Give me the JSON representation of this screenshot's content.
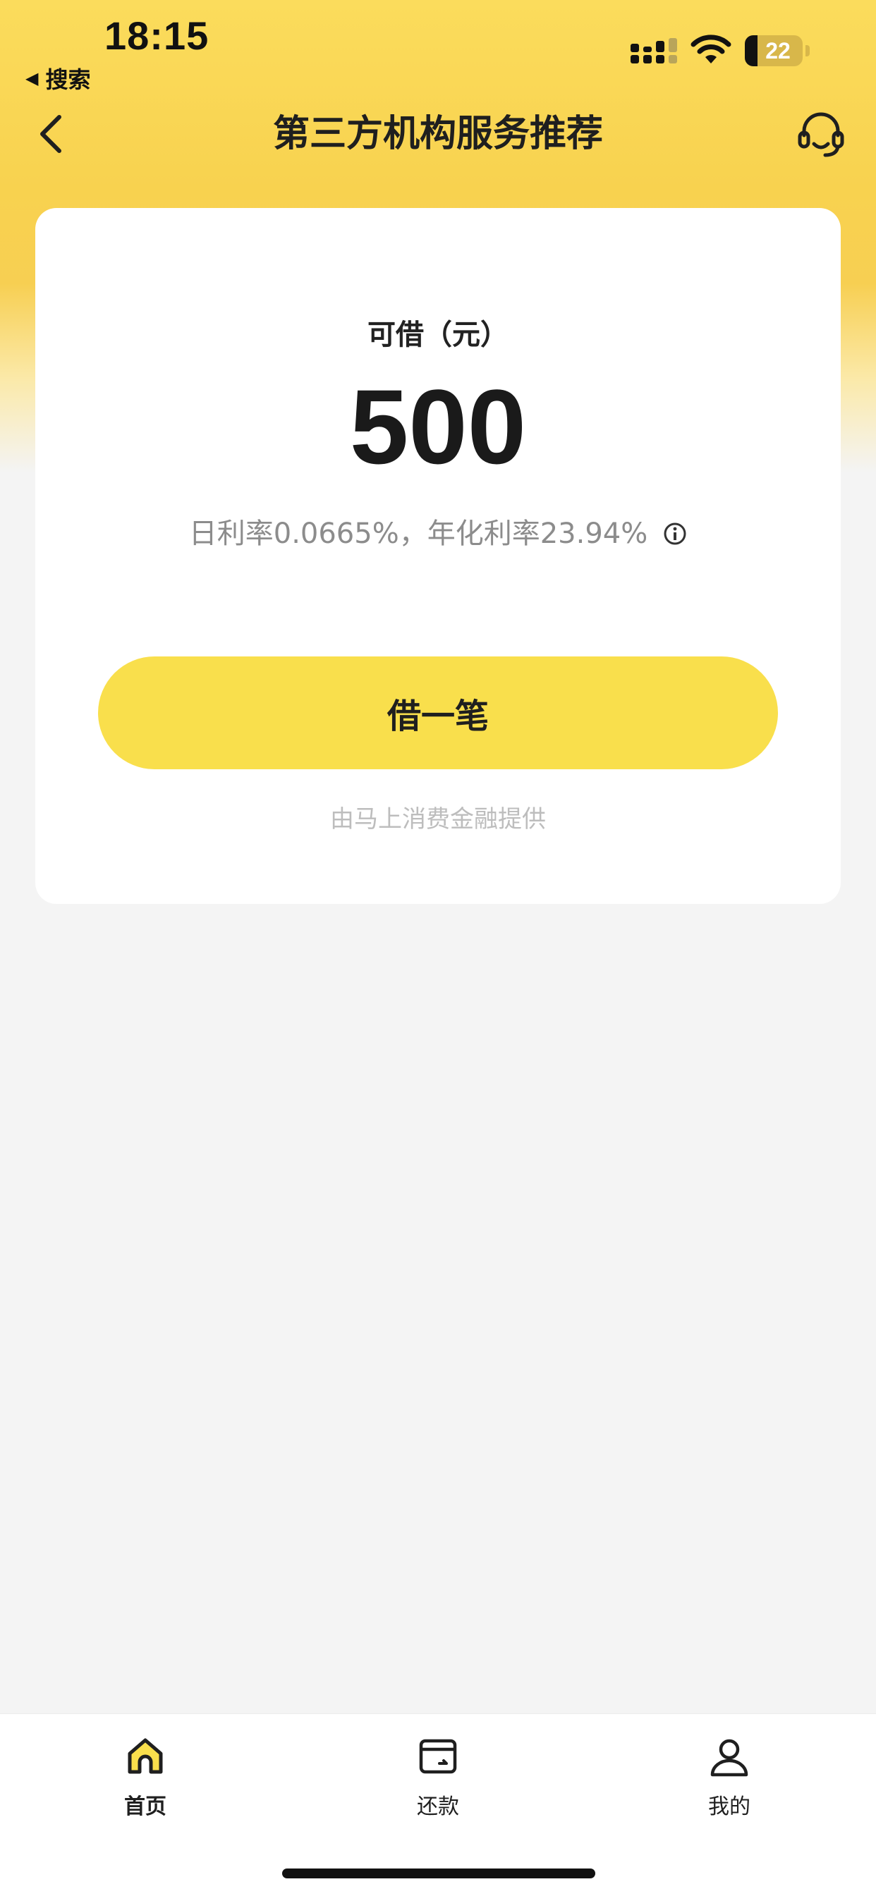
{
  "status_bar": {
    "time": "18:15",
    "back_app_label": "搜索",
    "battery_percent": "22"
  },
  "nav": {
    "title": "第三方机构服务推荐",
    "back_icon": "chevron-left-icon",
    "service_icon": "headset-icon"
  },
  "loan_card": {
    "label": "可借（元）",
    "amount": "500",
    "rate_text": "日利率0.0665%，年化利率23.94%",
    "borrow_button": "借一笔",
    "provider_note": "由马上消费金融提供"
  },
  "tabbar": {
    "items": [
      {
        "label": "首页",
        "icon": "home-icon",
        "active": true
      },
      {
        "label": "还款",
        "icon": "wallet-icon",
        "active": false
      },
      {
        "label": "我的",
        "icon": "user-icon",
        "active": false
      }
    ]
  },
  "colors": {
    "brand_yellow": "#f9df4c",
    "background": "#f4f4f4",
    "card": "#ffffff",
    "muted_text": "#8c8c8c"
  }
}
